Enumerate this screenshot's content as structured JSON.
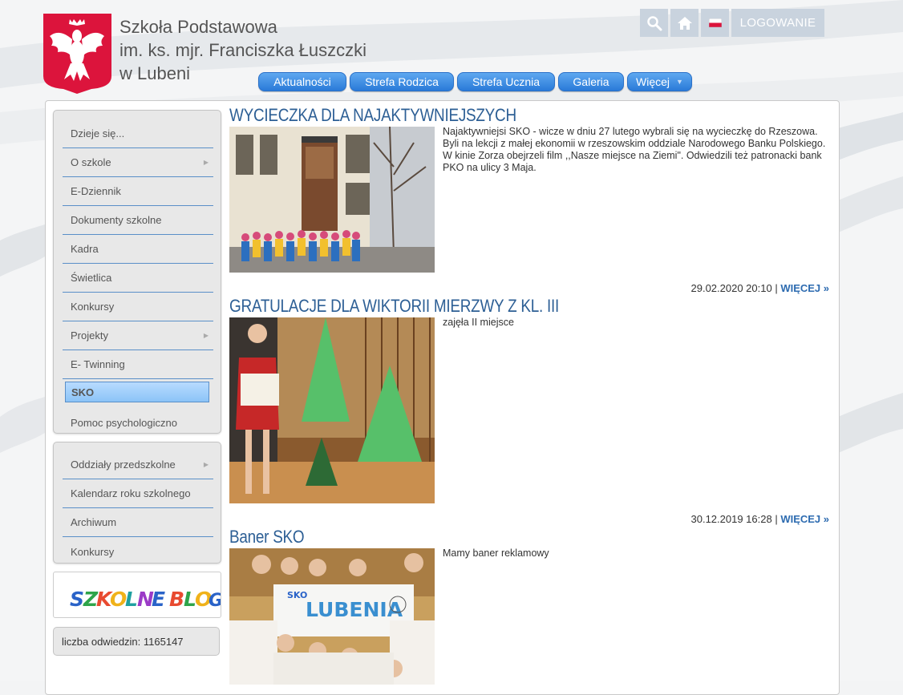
{
  "header": {
    "school_name_lines": [
      "Szkoła Podstawowa",
      "im. ks. mjr. Franciszka Łuszczki",
      "w Lubeni"
    ],
    "top_buttons": {
      "search_icon": "search-icon",
      "home_icon": "home-icon",
      "language_icon": "poland-flag-icon",
      "login_label": "LOGOWANIE"
    },
    "nav": [
      {
        "label": "Aktualności"
      },
      {
        "label": "Strefa Rodzica"
      },
      {
        "label": "Strefa Ucznia"
      },
      {
        "label": "Galeria"
      },
      {
        "label": "Więcej"
      }
    ]
  },
  "sidebar": {
    "menu1": [
      {
        "label": "Dzieje się...",
        "submenu": false
      },
      {
        "label": "O szkole",
        "submenu": true
      },
      {
        "label": "E-Dziennik",
        "submenu": false
      },
      {
        "label": "Dokumenty szkolne",
        "submenu": false
      },
      {
        "label": "Kadra",
        "submenu": false
      },
      {
        "label": "Świetlica",
        "submenu": false
      },
      {
        "label": "Konkursy",
        "submenu": false
      },
      {
        "label": "Projekty",
        "submenu": true
      },
      {
        "label": "E- Twinning",
        "submenu": false
      },
      {
        "label": "SKO",
        "submenu": false,
        "active": true
      },
      {
        "label": "Pomoc psychologiczno",
        "submenu": false
      }
    ],
    "menu2": [
      {
        "label": "Oddziały przedszkolne",
        "submenu": true
      },
      {
        "label": "Kalendarz roku szkolnego",
        "submenu": false
      },
      {
        "label": "Archiwum",
        "submenu": false
      },
      {
        "label": "Konkursy",
        "submenu": false
      }
    ],
    "blog_banner": "SZKOLNE BLOGI",
    "visit_counter": "liczba odwiedzin: 1165147"
  },
  "articles": [
    {
      "title": "WYCIECZKA DLA NAJAKTYWNIEJSZYCH",
      "text": "Najaktywniejsi SKO - wicze w dniu 27 lutego wybrali się na wycieczkę do Rzeszowa. Byli na lekcji z małej ekonomii w rzeszowskim oddziale  Narodowego Banku Polskiego. W kinie Zorza obejrzeli film ,,Nasze miejsce na Ziemi\". Odwiedzili też patronacki bank PKO na ulicy 3 Maja.",
      "date": "29.02.2020 20:10 | ",
      "more": "WIĘCEJ »"
    },
    {
      "title": "GRATULACJE DLA WIKTORII MIERZWY Z KL. III",
      "text": "zajęła II miejsce",
      "date": "30.12.2019 16:28 | ",
      "more": "WIĘCEJ »"
    },
    {
      "title": "Baner SKO",
      "text": "Mamy baner reklamowy",
      "banner_text": "LUBENIA",
      "banner_small": "SKO"
    }
  ],
  "colors": {
    "nav_blue": "#2a7ad8",
    "title_blue": "#2d5f95",
    "emblem_red": "#dc143c"
  }
}
